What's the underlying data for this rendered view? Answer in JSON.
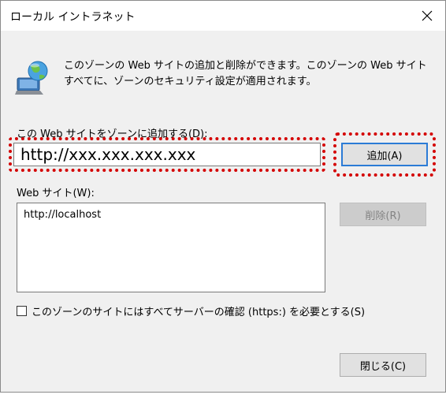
{
  "window": {
    "title": "ローカル イントラネット",
    "close_glyph": "×"
  },
  "info": {
    "text": "このゾーンの Web サイトの追加と削除ができます。このゾーンの Web サイトすべてに、ゾーンのセキュリティ設定が適用されます。",
    "icon": "globe-computer-icon"
  },
  "add_site": {
    "label": "この Web サイトをゾーンに追加する(D):",
    "input_value": "http://xxx.xxx.xxx.xxx",
    "add_button_label": "追加(A)"
  },
  "sites": {
    "label": "Web サイト(W):",
    "items": [
      "http://localhost"
    ],
    "remove_button_label": "削除(R)"
  },
  "https_option": {
    "label": "このゾーンのサイトにはすべてサーバーの確認 (https:) を必要とする(S)",
    "checked": false
  },
  "footer": {
    "close_button_label": "閉じる(C)"
  },
  "colors": {
    "highlight": "#d40000",
    "focus_border": "#2b7bd6",
    "dialog_bg": "#f0f0f0"
  }
}
